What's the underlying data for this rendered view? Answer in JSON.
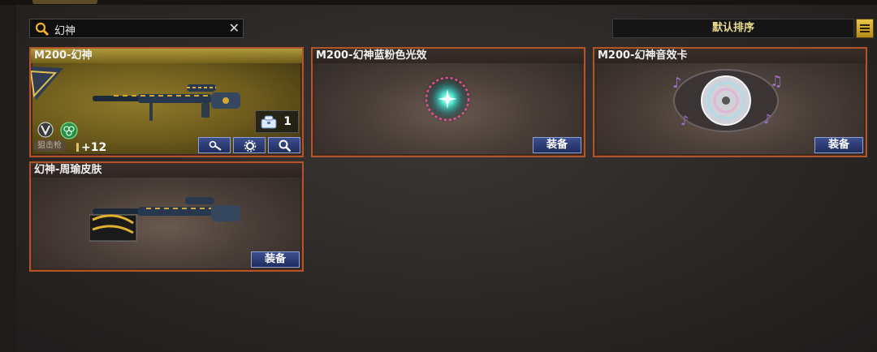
{
  "search": {
    "value": "幻神"
  },
  "sort": {
    "label": "默认排序"
  },
  "items": [
    {
      "title": "M200-幻神",
      "count": "1",
      "category": "狙击枪",
      "bonus": "+12"
    },
    {
      "title": "M200-幻神蓝粉色光效",
      "button": "装备"
    },
    {
      "title": "M200-幻神音效卡",
      "button": "装备"
    },
    {
      "title": "幻神-周瑜皮肤",
      "button": "装备"
    }
  ],
  "colors": {
    "card_border": "#b2542a",
    "button_blue": "#2f3f78",
    "sort_text": "#e9dc8e"
  }
}
